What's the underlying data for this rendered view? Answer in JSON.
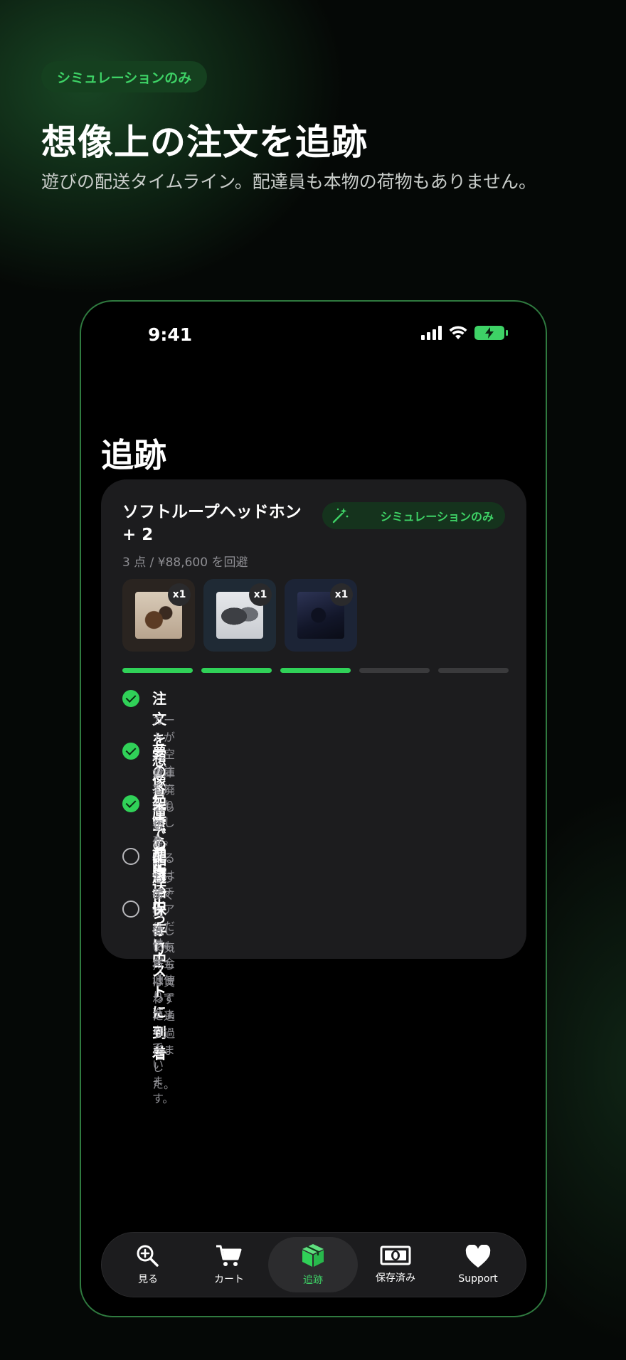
{
  "hero": {
    "badge": "シミュレーションのみ",
    "title": "想像上の注文を追跡",
    "subtitle": "遊びの配送タイムライン。配達員も本物の荷物もありません。"
  },
  "status_bar": {
    "time": "9:41",
    "icons": [
      "signal-icon",
      "wifi-icon",
      "battery-charging-icon"
    ]
  },
  "page": {
    "title": "追跡"
  },
  "order": {
    "title": "ソフトループヘッドホン + 2",
    "meta": "3 点 / ¥88,600 を回避",
    "badge": "シミュレーションのみ",
    "badge_icon": "magic-wand-icon",
    "items": [
      {
        "name": "coffee-set",
        "qty": "x1"
      },
      {
        "name": "headphones",
        "qty": "x1"
      },
      {
        "name": "projector",
        "qty": "x1"
      }
    ],
    "progress": {
      "completed": 3,
      "total": 5
    },
    "steps": [
      {
        "title": "注文を想像しました",
        "desc": "カートが架空の注文になりました。",
        "done": true
      },
      {
        "title": "夢の倉庫で準備中",
        "desc": "倉庫も廃棄もなく、あるのはリチュアルだけ。",
        "done": true
      },
      {
        "title": "架空の配送中",
        "desc": "想像上の荷物は予定通り進んでいます。",
        "done": true
      },
      {
        "title": "配達ごっこ中",
        "desc": "もうすぐ到着、でもお金は使っていません。",
        "done": false
      },
      {
        "title": "保存リストに到着",
        "desc": "欲しい気持ちは買わずに通り過ぎました。",
        "done": false
      }
    ]
  },
  "tabbar": {
    "active": "追跡",
    "tabs": [
      {
        "label": "見る",
        "icon": "magnifier-plus-icon"
      },
      {
        "label": "カート",
        "icon": "cart-icon"
      },
      {
        "label": "追跡",
        "icon": "package-icon"
      },
      {
        "label": "保存済み",
        "icon": "banknote-icon"
      },
      {
        "label": "Support",
        "icon": "heart-icon"
      }
    ]
  },
  "colors": {
    "accent": "#3ed266",
    "card": "#1c1c1e",
    "progress_done": "#30d158",
    "progress_todo": "#3a3a3c"
  }
}
